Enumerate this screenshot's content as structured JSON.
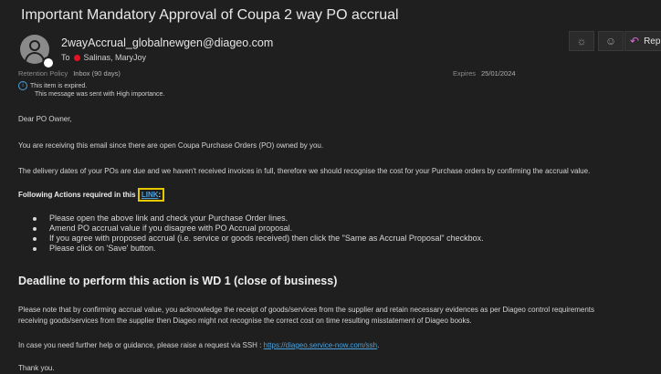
{
  "email": {
    "subject": "Important  Mandatory Approval of Coupa 2 way PO accrual",
    "sender": "2wayAccrual_globalnewgen@diageo.com",
    "to_label": "To",
    "to_name": "Salinas, MaryJoy",
    "retention_label": "Retention Policy",
    "retention_value": "Inbox (90 days)",
    "expires_label": "Expires",
    "expires_value": "25/01/2024",
    "expired_notice": "This item is expired.",
    "importance_notice": "This message was sent with High importance."
  },
  "toolbar": {
    "reply_label": "Reply",
    "icons": [
      "sun-icon",
      "emoji-icon",
      "reply-arrow-icon"
    ]
  },
  "body": {
    "greeting": "Dear PO Owner,",
    "para1": "You are receiving this email since there are open Coupa Purchase Orders (PO) owned by you.",
    "para2": "The delivery dates of your POs are due and we haven't received invoices in full, therefore we should recognise the cost for your Purchase orders by confirming the accrual value.",
    "actions_prefix": "Following Actions required in this",
    "actions_link": "LINK",
    "actions_suffix": ":",
    "bullets": [
      "Please open the above link and check your Purchase Order lines.",
      "Amend PO accrual value if you disagree with PO Accrual proposal.",
      "If you agree with proposed accrual (i.e. service or goods received) then click the \"Same as Accrual Proposal\" checkbox.",
      "Please click on 'Save' button."
    ],
    "deadline": "Deadline to perform this action is WD 1 (close of business)",
    "para3_line1": "Please note that by confirming accrual value, you acknowledge the receipt of goods/services from the supplier and retain necessary evidences as per Diageo control requirements",
    "para3_line2": "receiving goods/services from the supplier then Diageo might not recognise the correct cost on time resulting misstatement of Diageo books.",
    "help_prefix": "In case you need further help or guidance, please raise a request via SSH :",
    "help_link": "https://diageo.service-now.com/ssh",
    "help_suffix": ".",
    "thanks": "Thank you."
  }
}
